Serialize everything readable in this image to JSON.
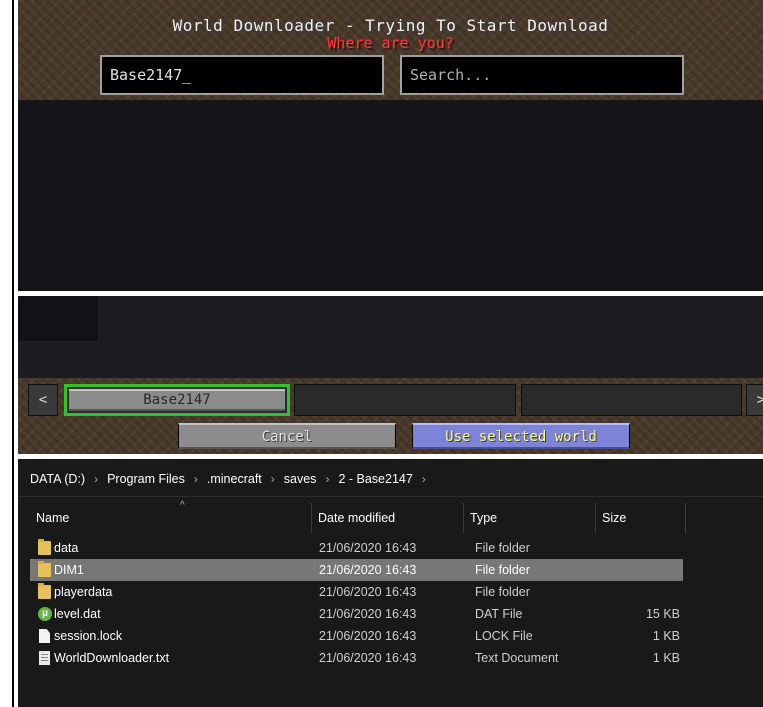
{
  "minecraft": {
    "title": "World Downloader - Trying To Start Download",
    "subtitle": "Where are you?",
    "name_input_value": "Base2147_",
    "search_placeholder": "Search...",
    "nav_prev": "<",
    "nav_next": ">",
    "selected_world": "Base2147",
    "cancel_label": "Cancel",
    "use_selected_label": "Use selected world",
    "colors": {
      "title": "#f2f2f2",
      "subtitle": "#ff3838",
      "selection_border": "#2fc32f",
      "use_button": "#7d83d6"
    }
  },
  "explorer": {
    "breadcrumbs": [
      "DATA (D:)",
      "Program Files",
      ".minecraft",
      "saves",
      "2 - Base2147"
    ],
    "columns": {
      "name": "Name",
      "date": "Date modified",
      "type": "Type",
      "size": "Size"
    },
    "files": [
      {
        "name": "data",
        "date": "21/06/2020 16:43",
        "type": "File folder",
        "size": "",
        "icon": "folder-icon"
      },
      {
        "name": "DIM1",
        "date": "21/06/2020 16:43",
        "type": "File folder",
        "size": "",
        "icon": "folder-icon",
        "selected": true
      },
      {
        "name": "playerdata",
        "date": "21/06/2020 16:43",
        "type": "File folder",
        "size": "",
        "icon": "folder-icon"
      },
      {
        "name": "level.dat",
        "date": "21/06/2020 16:43",
        "type": "DAT File",
        "size": "15 KB",
        "icon": "utorrent-icon"
      },
      {
        "name": "session.lock",
        "date": "21/06/2020 16:43",
        "type": "LOCK File",
        "size": "1 KB",
        "icon": "file-icon"
      },
      {
        "name": "WorldDownloader.txt",
        "date": "21/06/2020 16:43",
        "type": "Text Document",
        "size": "1 KB",
        "icon": "text-file-icon"
      }
    ],
    "colors": {
      "background": "#191919",
      "selected_row": "#777777"
    }
  }
}
